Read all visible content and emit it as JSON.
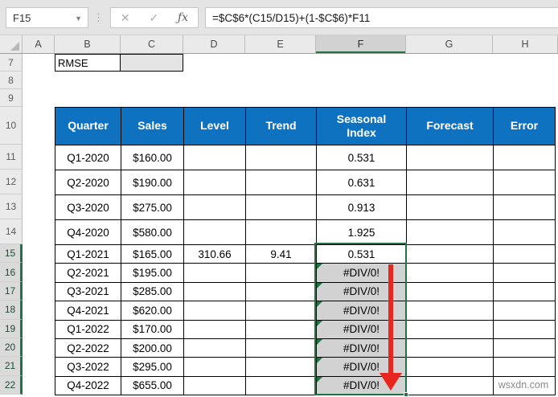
{
  "formula_bar": {
    "name_box": "F15",
    "cancel_icon": "✕",
    "enter_icon": "✓",
    "fx_label": "ƒx",
    "formula": "=$C$6*(C15/D15)+(1-$C$6)*F11"
  },
  "column_headers": [
    "A",
    "B",
    "C",
    "D",
    "E",
    "F",
    "G",
    "H"
  ],
  "selected_column": "F",
  "row_numbers": [
    7,
    8,
    9,
    10,
    11,
    12,
    13,
    14,
    15,
    16,
    17,
    18,
    19,
    20,
    21,
    22
  ],
  "selected_rows": [
    15,
    16,
    17,
    18,
    19,
    20,
    21,
    22
  ],
  "rmse": {
    "label": "RMSE",
    "value": ""
  },
  "table": {
    "headers": [
      "Quarter",
      "Sales",
      "Level",
      "Trend",
      "Seasonal Index",
      "Forecast",
      "Error"
    ],
    "rows": [
      {
        "row": 11,
        "cells": [
          "Q1-2020",
          "$160.00",
          "",
          "",
          "0.531",
          "",
          ""
        ]
      },
      {
        "row": 12,
        "cells": [
          "Q2-2020",
          "$190.00",
          "",
          "",
          "0.631",
          "",
          ""
        ]
      },
      {
        "row": 13,
        "cells": [
          "Q3-2020",
          "$275.00",
          "",
          "",
          "0.913",
          "",
          ""
        ]
      },
      {
        "row": 14,
        "cells": [
          "Q4-2020",
          "$580.00",
          "",
          "",
          "1.925",
          "",
          ""
        ]
      },
      {
        "row": 15,
        "cells": [
          "Q1-2021",
          "$165.00",
          "310.66",
          "9.41",
          "0.531",
          "",
          ""
        ]
      },
      {
        "row": 16,
        "cells": [
          "Q2-2021",
          "$195.00",
          "",
          "",
          "#DIV/0!",
          "",
          ""
        ]
      },
      {
        "row": 17,
        "cells": [
          "Q3-2021",
          "$285.00",
          "",
          "",
          "#DIV/0!",
          "",
          ""
        ]
      },
      {
        "row": 18,
        "cells": [
          "Q4-2021",
          "$620.00",
          "",
          "",
          "#DIV/0!",
          "",
          ""
        ]
      },
      {
        "row": 19,
        "cells": [
          "Q1-2022",
          "$170.00",
          "",
          "",
          "#DIV/0!",
          "",
          ""
        ]
      },
      {
        "row": 20,
        "cells": [
          "Q2-2022",
          "$200.00",
          "",
          "",
          "#DIV/0!",
          "",
          ""
        ]
      },
      {
        "row": 21,
        "cells": [
          "Q3-2022",
          "$295.00",
          "",
          "",
          "#DIV/0!",
          "",
          ""
        ]
      },
      {
        "row": 22,
        "cells": [
          "Q4-2022",
          "$655.00",
          "",
          "",
          "#DIV/0!",
          "",
          ""
        ]
      }
    ],
    "error_value": "#DIV/0!"
  },
  "watermark": "wsxdn.com",
  "colors": {
    "header_blue": "#0F72C1",
    "selection_green": "#217346",
    "error_cell_gray": "#D2D2D2",
    "arrow_red": "#E8261D"
  }
}
